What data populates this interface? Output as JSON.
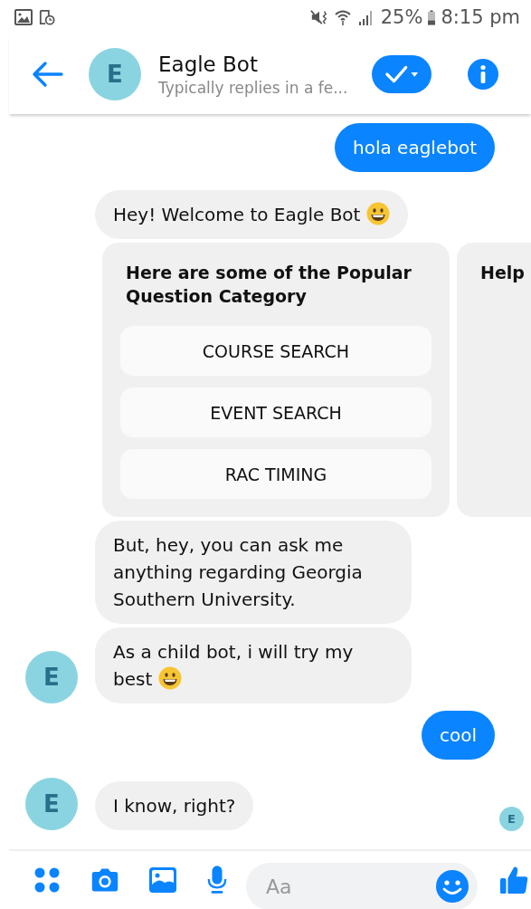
{
  "status_bar": {
    "battery_text": "25%",
    "time": "8:15 pm"
  },
  "header": {
    "avatar_letter": "E",
    "title": "Eagle Bot",
    "subtitle": "Typically replies in a fe..."
  },
  "messages": [
    {
      "kind": "sent",
      "text": "hola eaglebot"
    },
    {
      "kind": "received",
      "text": "Hey! Welcome to Eagle Bot",
      "emoji": true,
      "avatar": false
    },
    {
      "kind": "carousel",
      "cards": [
        {
          "title": "Here are some of the Popular Question Category",
          "buttons": [
            "COURSE SEARCH",
            "EVENT SEARCH",
            "RAC TIMING"
          ]
        },
        {
          "title": "Help"
        }
      ]
    },
    {
      "kind": "received",
      "text": "But, hey, you can ask me anything regarding Georgia Southern University.",
      "emoji": false,
      "avatar": false
    },
    {
      "kind": "received",
      "text": "As a child bot, i will try my best",
      "emoji": true,
      "avatar": true,
      "avatar_letter": "E"
    },
    {
      "kind": "sent",
      "text": "cool"
    },
    {
      "kind": "received",
      "text": "I know, right?",
      "emoji": false,
      "avatar": true,
      "avatar_letter": "E"
    }
  ],
  "seen_by": {
    "avatar_letter": "E"
  },
  "composer": {
    "placeholder": "Aa"
  }
}
